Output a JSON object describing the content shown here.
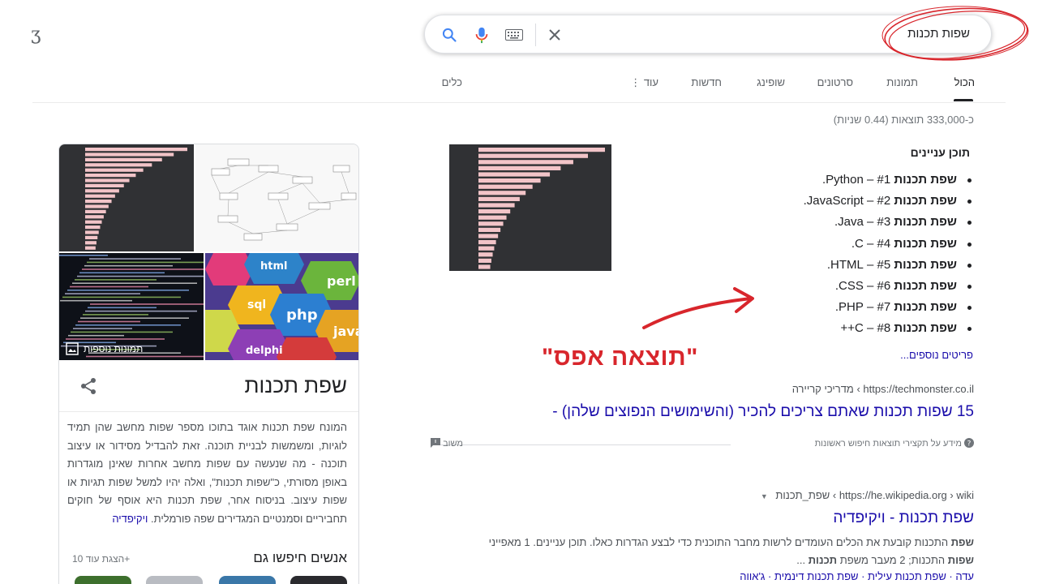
{
  "header": {
    "logo_glyph": "ʒ",
    "search_query": "שפות תכנות"
  },
  "tabs": [
    {
      "label": "הכול",
      "active": true
    },
    {
      "label": "תמונות"
    },
    {
      "label": "סרטונים"
    },
    {
      "label": "שופינג"
    },
    {
      "label": "חדשות"
    },
    {
      "label": "⋮ עוד"
    },
    {
      "label": "כלים"
    }
  ],
  "results_stats": "כ-333,000 תוצאות (0.44 שניות)",
  "snippet": {
    "title": "תוכן עניינים",
    "items": [
      {
        "bold": "שפת תכנות",
        "rest": " #1 – Python."
      },
      {
        "bold": "שפת תכנות",
        "rest": " #2 – JavaScript."
      },
      {
        "bold": "שפת תכנות",
        "rest": " #3 – Java."
      },
      {
        "bold": "שפת תכנות",
        "rest": " #4 – C."
      },
      {
        "bold": "שפת תכנות",
        "rest": " #5 – HTML."
      },
      {
        "bold": "שפת תכנות",
        "rest": " #6 – CSS."
      },
      {
        "bold": "שפת תכנות",
        "rest": " #7 – PHP."
      },
      {
        "bold": "שפת תכנות",
        "rest": " #8 – C++"
      }
    ],
    "more_link": "פריטים נוספים..."
  },
  "annotation": "\"תוצאה אפס\"",
  "result1": {
    "cite": "https://techmonster.co.il › מדריכי קריירה",
    "title": "15 שפות תכנות שאתם צריכים להכיר (והשימושים הנפוצים שלהן) -",
    "about": "מידע על תקצירי תוצאות חיפוש ראשונות",
    "feedback": "משוב"
  },
  "result2": {
    "cite": "https://he.wikipedia.org › wiki › שפת_תכנות",
    "title": "שפת תכנות - ויקיפדיה",
    "snippet_bold1": "שפת",
    "snippet_text1": " התכנות קובעת את הכלים העומדים לרשות מחבר התוכנית כדי לבצע הגדרות כאלו. תוכן עניינים. 1 מאפייני ",
    "snippet_bold2": "שפות",
    "snippet_text2": " התכנות; 2 מעבר משפת ",
    "snippet_bold3": "תכנות",
    "snippet_text3": " ...",
    "sitelinks": "עדה · שפת תכנות עילית · שפת תכנות דינמית · ג'אווה"
  },
  "knowledge_panel": {
    "more_images": "תמונות נוספות",
    "title": "שפת תכנות",
    "description": "המונח שפת תכנות אוגד בתוכו מספר שפות מחשב שהן תמיד לוגיות, ומשמשות לבניית תוכנה. זאת להבדיל מסידור או עיצוב תוכנה - מה שנעשה עם שפות מחשב אחרות שאינן מוגדרות באופן מסורתי, כ\"שפות תכנות\", ואלה יהיו למשל שפות תגיות או שפות עיצוב. בניסוח אחר, שפת תכנות היא אוסף של חוקים תחביריים וסמנטיים המגדירים שפה פורמלית.",
    "wiki_link": "ויקיפדיה",
    "people_also_search": "אנשים חיפשו גם",
    "view_more": "הצגת עוד 10+"
  },
  "colors": {
    "link": "#1a0dab",
    "annotation_red": "#d8262c",
    "chart_bg": "#303134",
    "chart_bar": "#f2c4c8"
  }
}
